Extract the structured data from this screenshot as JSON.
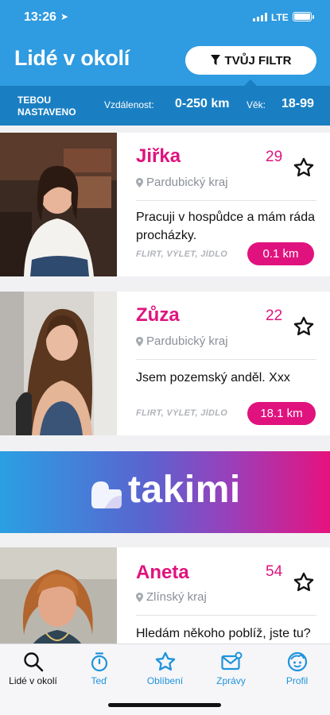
{
  "status_bar": {
    "time": "13:26",
    "network": "LTE"
  },
  "header": {
    "title": "Lidé v okolí",
    "filter_button": "TVŮJ FILTR"
  },
  "filter_bar": {
    "set_label": [
      "TEBOU",
      "NASTAVENO"
    ],
    "distance_label": "Vzdálenost:",
    "distance_value": "0-250 km",
    "age_label": "Věk:",
    "age_value": "18-99"
  },
  "profiles": [
    {
      "name": "Jiřka",
      "age": "29",
      "region": "Pardubický kraj",
      "bio": "Pracuji v hospůdce a mám ráda procházky.",
      "tags": "FLIRT, VÝLET, JÍDLO",
      "distance": "0.1 km"
    },
    {
      "name": "Zůza",
      "age": "22",
      "region": "Pardubický kraj",
      "bio": "Jsem pozemský anděl. Xxx",
      "tags": "FLIRT, VÝLET, JÍDLO",
      "distance": "18.1 km"
    },
    {
      "name": "Aneta",
      "age": "54",
      "region": "Zlínský kraj",
      "bio": "Hledám někoho poblíž, jste tu?",
      "tags": "",
      "distance": ""
    }
  ],
  "banner": {
    "brand": "takimi"
  },
  "nav": {
    "items": [
      {
        "label": "Lidé v okolí",
        "icon": "search-icon"
      },
      {
        "label": "Teď",
        "icon": "stopwatch-icon"
      },
      {
        "label": "Oblíbení",
        "icon": "star-icon"
      },
      {
        "label": "Zprávy",
        "icon": "envelope-icon"
      },
      {
        "label": "Profil",
        "icon": "face-icon"
      }
    ]
  },
  "colors": {
    "header": "#2f9be0",
    "filter_bar": "#1a7fc2",
    "accent": "#e0137e",
    "nav_active": "#1f93dc"
  }
}
